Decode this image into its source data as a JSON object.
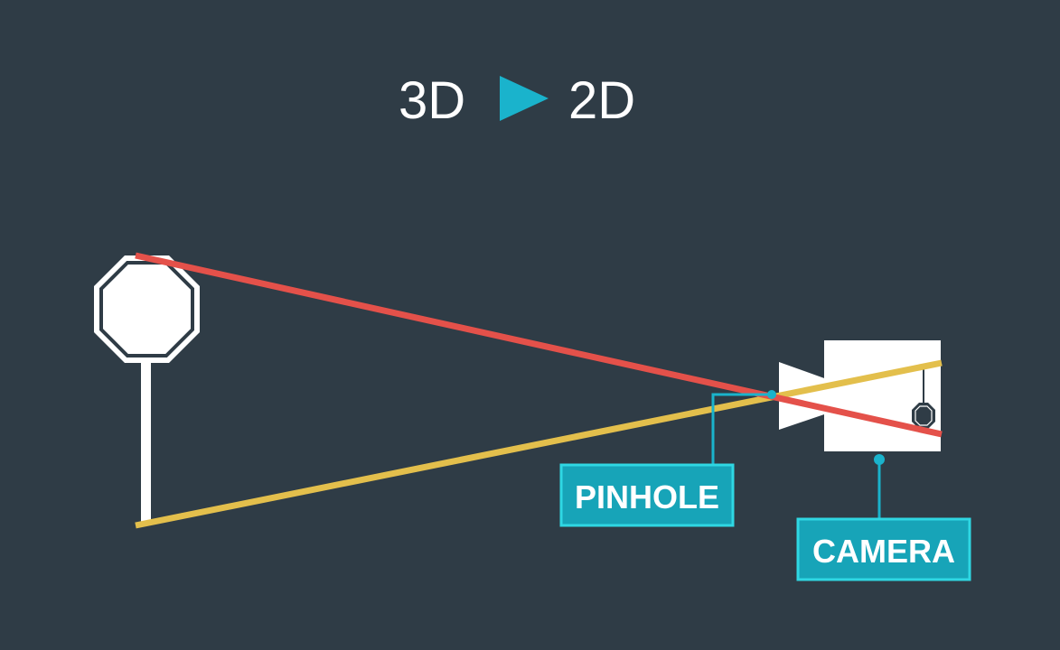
{
  "title": {
    "from_label": "3D",
    "to_label": "2D",
    "arrow_icon": "play-triangle-icon"
  },
  "labels": {
    "pinhole": "PINHOLE",
    "camera": "CAMERA"
  },
  "icons": {
    "stop_sign": "stop-sign-icon",
    "camera": "camera-icon",
    "projected_image": "stop-sign-icon"
  },
  "colors": {
    "background": "#2f3c46",
    "accent": "#1ab3cc",
    "label_box": "#17a4b8",
    "label_border": "#2fd7e3",
    "top_ray": "#e4514a",
    "bottom_ray": "#e3bf4c",
    "object": "#ffffff"
  }
}
